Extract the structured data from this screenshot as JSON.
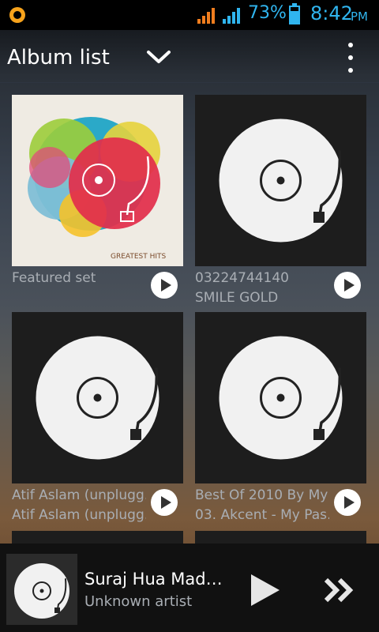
{
  "status_bar": {
    "battery_percent": "73%",
    "battery_level": 0.73,
    "time": "8:42",
    "ampm": "PM",
    "accent_color": "#30b5ef"
  },
  "app_bar": {
    "title": "Album list"
  },
  "albums": [
    {
      "line1": "Featured set",
      "line2": "",
      "art": "greatest-hits-cover",
      "art_text": "GREATEST HITS"
    },
    {
      "line1": "03224744140",
      "line2": "SMILE GOLD",
      "art": "turntable-icon"
    },
    {
      "line1": "Atif Aslam (unplugg…",
      "line2": "Atif Aslam (unplugg…",
      "art": "turntable-icon"
    },
    {
      "line1": "Best Of 2010 By My…",
      "line2": "03. Akcent - My Pas…",
      "art": "turntable-icon"
    }
  ],
  "now_playing": {
    "title": "Suraj Hua Mad…",
    "artist": "Unknown artist"
  }
}
